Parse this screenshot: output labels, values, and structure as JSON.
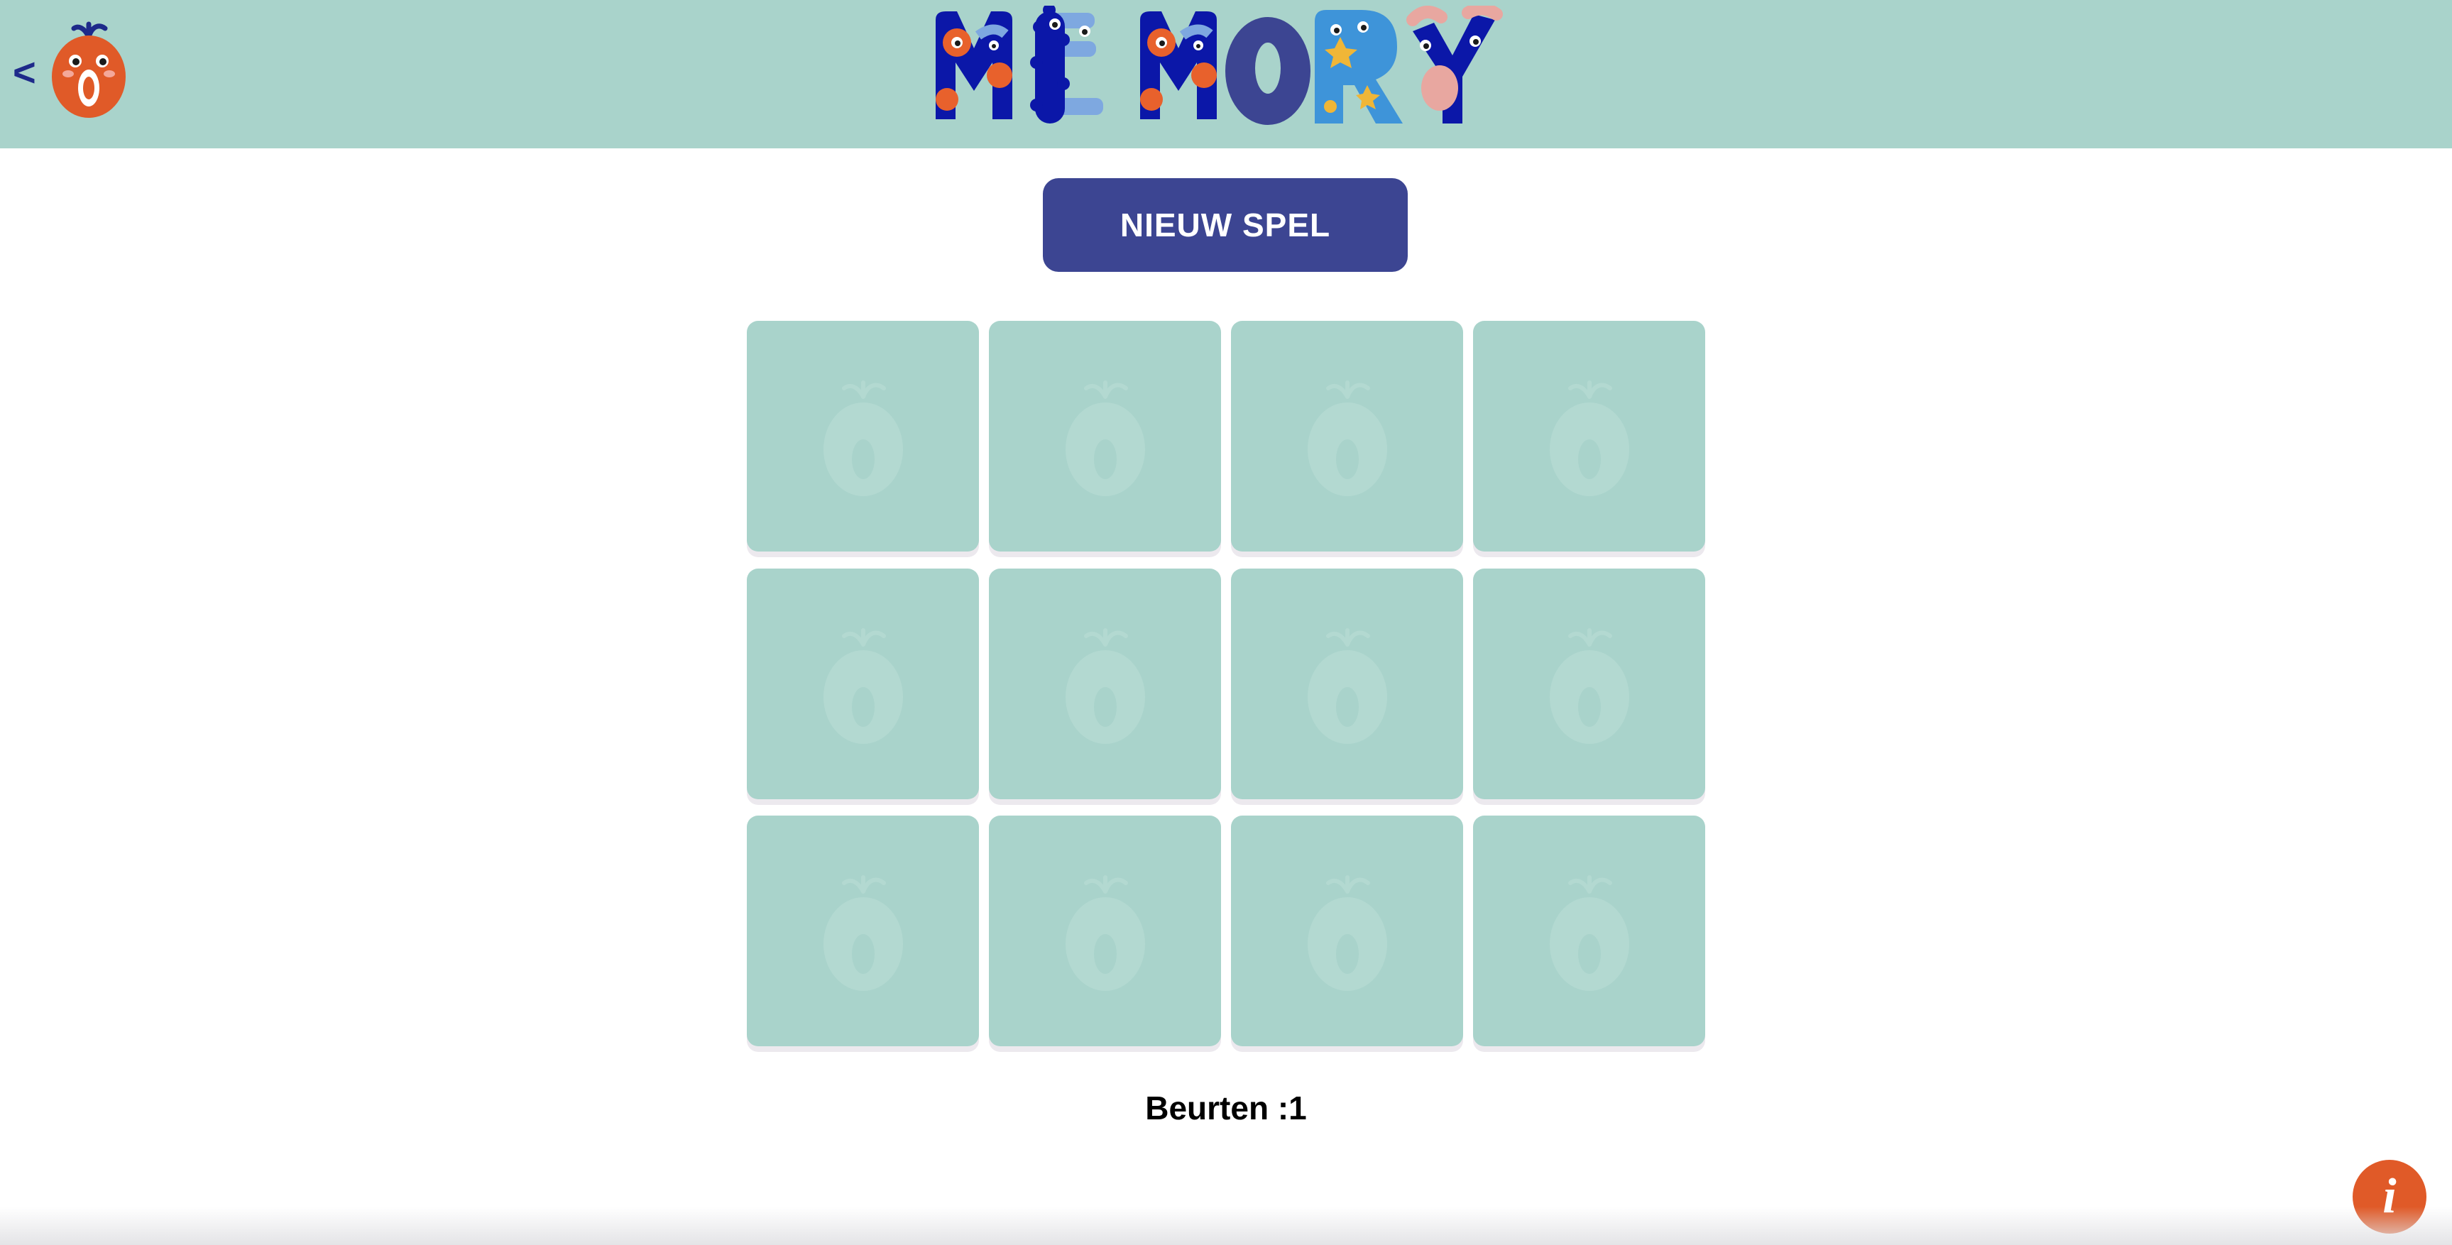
{
  "header": {
    "back_label": "<",
    "logo_text": "MEMORY",
    "colors": {
      "background": "#a9d3cb",
      "navy": "#1e2a8a",
      "deep_blue": "#0b17a8",
      "light_blue": "#7ea8e0",
      "sky_blue": "#3e94d9",
      "orange": "#e8612c",
      "pink": "#e8a7a0",
      "yellow": "#f0b637"
    }
  },
  "controls": {
    "new_game_label": "NIEUW SPEL",
    "button_color": "#3c4592"
  },
  "board": {
    "rows": 3,
    "columns": 4,
    "card_back_icon": "tomato-mascot-icon",
    "cards": [
      {
        "state": "face-down"
      },
      {
        "state": "face-down"
      },
      {
        "state": "face-down"
      },
      {
        "state": "face-down"
      },
      {
        "state": "face-down"
      },
      {
        "state": "face-down"
      },
      {
        "state": "face-down"
      },
      {
        "state": "face-down"
      },
      {
        "state": "face-down"
      },
      {
        "state": "face-down"
      },
      {
        "state": "face-down"
      },
      {
        "state": "face-down"
      }
    ]
  },
  "status": {
    "turns_label": "Beurten :",
    "turns_value": "1"
  },
  "info": {
    "label": "i",
    "color": "#e05a28"
  }
}
